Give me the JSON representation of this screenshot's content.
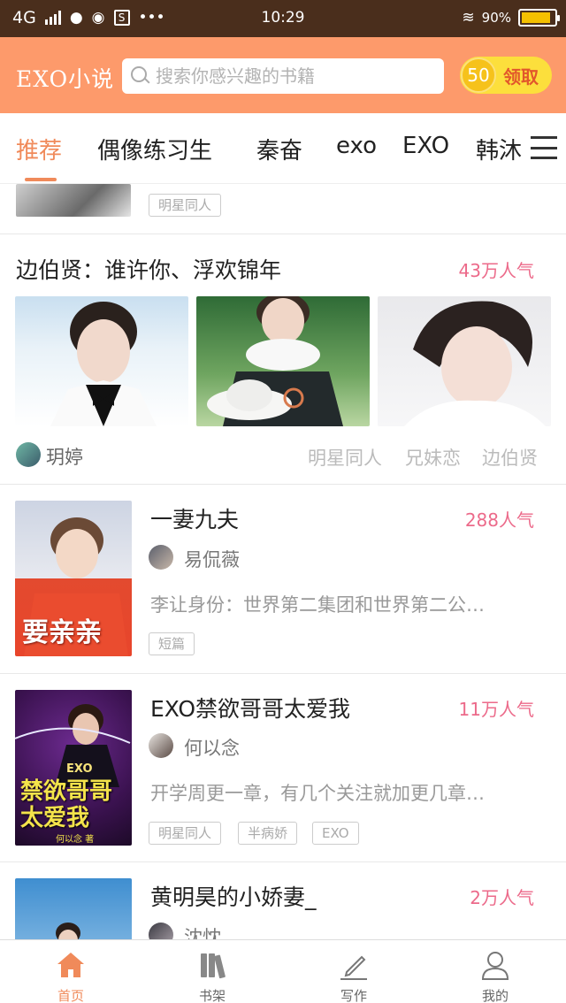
{
  "status_bar": {
    "network": "4G",
    "time": "10:29",
    "battery": "90%",
    "battery_level": 0.9
  },
  "header": {
    "logo": "EXO小说",
    "search_placeholder": "搜索你感兴趣的书籍",
    "claim_coins": "50",
    "claim_label": "领取"
  },
  "tabs": [
    "推荐",
    "偶像练习生",
    "秦奋",
    "exo",
    "EXO",
    "韩沐"
  ],
  "partial_top": {
    "tag": "明星同人"
  },
  "featured": {
    "title": "边伯贤：谁许你、浮欢锦年",
    "popularity": "43万人气",
    "author": "玥婷",
    "keywords": [
      "明星同人",
      "兄妹恋",
      "边伯贤"
    ]
  },
  "books": [
    {
      "title": "一妻九夫",
      "popularity": "288人气",
      "author": "易侃薇",
      "description": "李让身份：世界第二集团和世界第二公…",
      "cover_text": "要亲亲",
      "tags": [
        "短篇"
      ]
    },
    {
      "title": "EXO禁欲哥哥太爱我",
      "popularity": "11万人气",
      "author": "何以念",
      "description": "开学周更一章，有几个关注就加更几章…",
      "cover_text": "禁欲哥哥太爱我",
      "cover_subtext": "EXO",
      "cover_author": "何以念 著",
      "tags": [
        "明星同人",
        "半病娇",
        "EXO"
      ]
    },
    {
      "title": "黄明昊的小娇妻_",
      "popularity": "2万人气",
      "author": "沈忱"
    }
  ],
  "bottom_nav": [
    {
      "label": "首页",
      "icon": "home-icon"
    },
    {
      "label": "书架",
      "icon": "bookshelf-icon"
    },
    {
      "label": "写作",
      "icon": "pen-icon"
    },
    {
      "label": "我的",
      "icon": "user-icon"
    }
  ],
  "colors": {
    "accent": "#f08a5a",
    "header_bg": "#fd9a6b",
    "popularity": "#ec6a8a",
    "status_bar": "#4a2e1c"
  }
}
